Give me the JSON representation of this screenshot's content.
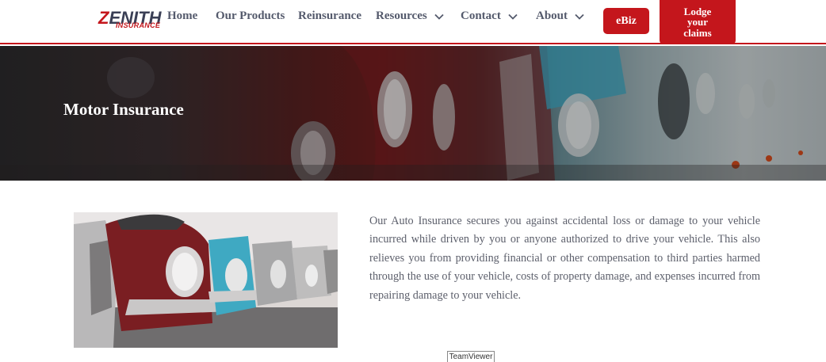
{
  "brand": {
    "logo_main": "ZENITH",
    "logo_sub": "INSURANCE",
    "accent_color": "#c4161c"
  },
  "nav": {
    "items": [
      {
        "label": "Home",
        "has_dropdown": false
      },
      {
        "label": "Our Products",
        "has_dropdown": false
      },
      {
        "label": "Reinsurance",
        "has_dropdown": false
      },
      {
        "label": "Resources",
        "has_dropdown": true
      },
      {
        "label": "Contact",
        "has_dropdown": true
      },
      {
        "label": "About",
        "has_dropdown": true
      }
    ],
    "ebiz_label": "eBiz",
    "lodge_label_lines": [
      "Lodge",
      "your",
      "claims"
    ]
  },
  "hero": {
    "title": "Motor Insurance"
  },
  "content": {
    "paragraph": "Our Auto Insurance secures you against accidental loss or damage to your vehicle incurred while driven by you or anyone authorized to drive your vehicle. This also relieves you from providing financial or other compensation to third parties harmed through the use of your vehicle, costs of property damage, and expenses incurred from repairing damage to your vehicle."
  },
  "overlay": {
    "teamviewer_label": "TeamViewer"
  }
}
